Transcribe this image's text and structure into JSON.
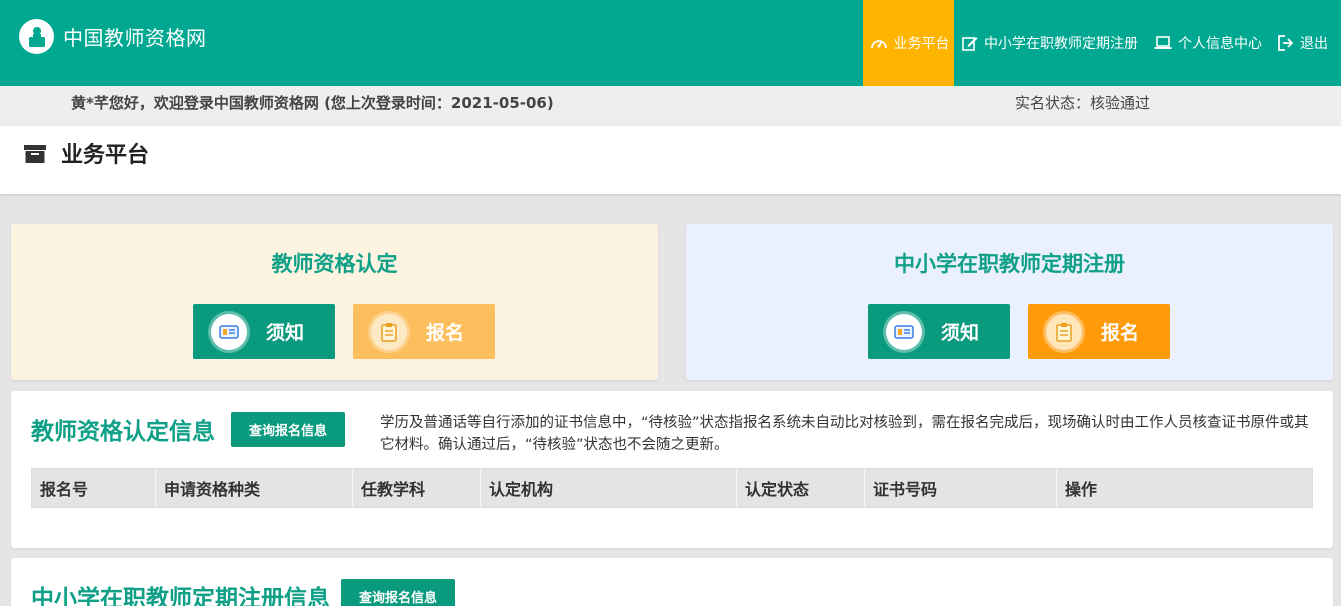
{
  "header": {
    "logo_text": "中国教师资格网",
    "nav": [
      {
        "label": "业务平台",
        "icon": "dashboard-icon",
        "active": true
      },
      {
        "label": "中小学在职教师定期注册",
        "icon": "edit-icon",
        "active": false
      },
      {
        "label": "个人信息中心",
        "icon": "laptop-icon",
        "active": false
      },
      {
        "label": "退出",
        "icon": "logout-icon",
        "active": false
      }
    ]
  },
  "welcome": {
    "text": "黄*芊您好，欢迎登录中国教师资格网 (您上次登录时间：2021-05-06)",
    "status": "实名状态：核验通过"
  },
  "page_title": "业务平台",
  "cards": [
    {
      "title": "教师资格认定",
      "buttons": [
        {
          "label": "须知",
          "icon": "id-card-icon"
        },
        {
          "label": "报名",
          "icon": "clipboard-icon"
        }
      ]
    },
    {
      "title": "中小学在职教师定期注册",
      "buttons": [
        {
          "label": "须知",
          "icon": "id-card-icon"
        },
        {
          "label": "报名",
          "icon": "clipboard-icon"
        }
      ]
    }
  ],
  "sections": [
    {
      "title": "教师资格认定信息",
      "query_label": "查询报名信息",
      "notice": "学历及普通话等自行添加的证书信息中，“待核验”状态指报名系统未自动比对核验到，需在报名完成后，现场确认时由工作人员核查证书原件或其它材料。确认通过后，“待核验”状态也不会随之更新。",
      "columns": [
        "报名号",
        "申请资格种类",
        "任教学科",
        "认定机构",
        "认定状态",
        "证书号码",
        "操作"
      ]
    },
    {
      "title": "中小学在职教师定期注册信息",
      "query_label": "查询报名信息"
    }
  ],
  "colors": {
    "brand_teal": "#00a891",
    "active_nav": "#ffb400",
    "button_teal": "#0a9a7e",
    "button_orange": "#ff9b0b",
    "button_light_orange": "#fdbf5e"
  }
}
